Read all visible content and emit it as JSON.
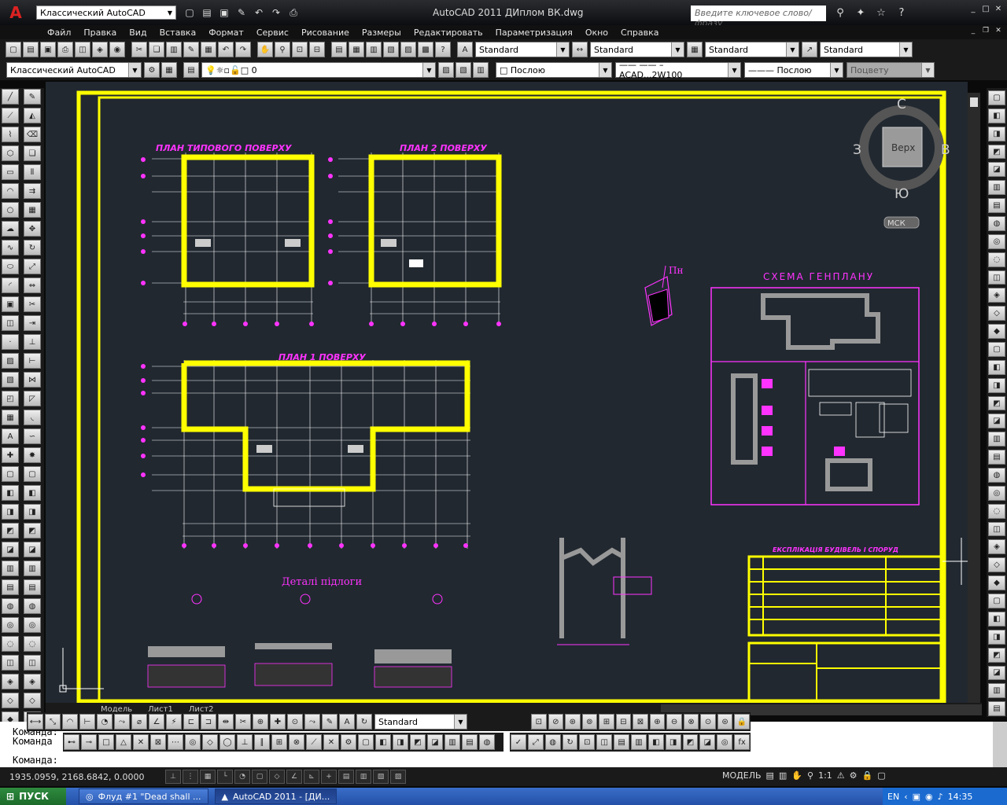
{
  "app": {
    "title": "AutoCAD 2011    ДИплом ВК.dwg",
    "workspace": "Классический AutoCAD",
    "search_placeholder": "Введите ключевое слово/фразу"
  },
  "menu": [
    "Файл",
    "Правка",
    "Вид",
    "Вставка",
    "Формат",
    "Сервис",
    "Рисование",
    "Размеры",
    "Редактировать",
    "Параметризация",
    "Окно",
    "Справка"
  ],
  "styles": {
    "text_style": "Standard",
    "dim_style": "Standard",
    "table_style": "Standard",
    "mleader_style": "Standard"
  },
  "layers": {
    "workspace": "Классический AutoCAD",
    "current_layer": "0",
    "color": "Послою",
    "linetype": "ACAD...2W100",
    "lineweight": "Послою",
    "plotstyle": "Поцвету"
  },
  "viewcube": {
    "north": "С",
    "south": "Ю",
    "west": "З",
    "east": "В",
    "face": "Верх",
    "ucs": "МСК"
  },
  "drawing": {
    "plan_typical": "ПЛАН ТИПОВОГО ПОВЕРХУ",
    "plan_2": "ПЛАН 2 ПОВЕРХУ",
    "plan_1": "ПЛАН 1 ПОВЕРХУ",
    "genplan": "СХЕМА  ГЕНПЛАНУ",
    "north": "Пн",
    "floor_details": "Деталі підлоги",
    "explication": "ЕКСПЛІКАЦІЯ БУДІВЕЛЬ І СПОРУД"
  },
  "layout_tabs": [
    "Модель",
    "Лист1",
    "Лист2"
  ],
  "annotation_style": "Standard",
  "command": {
    "line1": "Команда:",
    "line2": "Команда",
    "line3": "Команда:"
  },
  "status": {
    "coords": "1935.0959, 2168.6842, 0.0000",
    "model": "МОДЕЛЬ",
    "scale": "1:1"
  },
  "taskbar": {
    "start": "ПУСК",
    "task1": "Флуд #1 \"Dead shall ...",
    "task2": "AutoCAD 2011 - [ДИ...",
    "lang": "EN",
    "time": "14:35"
  }
}
